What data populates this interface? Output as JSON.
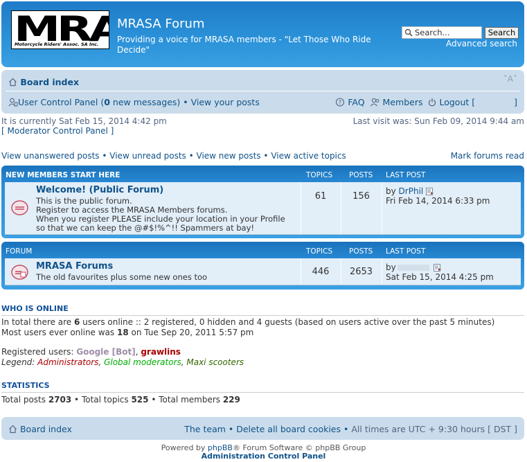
{
  "header": {
    "logo_text": "MRA",
    "logo_subtitle": "Motorcycle Riders' Assoc. SA Inc.",
    "site_title": "MRASA Forum",
    "site_description": "Providing a voice for MRASA members - \"Let Those Who Ride Decide\"",
    "search_placeholder": "Search...",
    "search_button": "Search",
    "advanced_search": "Advanced search"
  },
  "navbar": {
    "board_index": "Board index",
    "font_size": "˅A˄",
    "ucp_label": "User Control Panel",
    "ucp_open": " (",
    "new_messages_count": "0",
    "new_messages_text": " new messages)",
    "sep": " • ",
    "view_posts": "View your posts",
    "faq": "FAQ",
    "members": "Members",
    "logout": "Logout [",
    "logout_close": "]"
  },
  "info": {
    "current_time": "It is currently Sat Feb 15, 2014 4:42 pm",
    "mcp": "[ Moderator Control Panel ]",
    "last_visit": "Last visit was: Sun Feb 09, 2014 9:44 am"
  },
  "view_links": {
    "unanswered": "View unanswered posts",
    "unread": "View unread posts",
    "new": "View new posts",
    "active": "View active topics",
    "sep": " • ",
    "mark_read": "Mark forums read"
  },
  "columns": {
    "topics": "TOPICS",
    "posts": "POSTS",
    "last_post": "LAST POST"
  },
  "categories": [
    {
      "name": "NEW MEMBERS START HERE",
      "forum": {
        "title": "Welcome! (Public Forum)",
        "desc1": "This is the public forum.",
        "desc2": "Register to access the MRASA Members forums.",
        "desc3": "When you register PLEASE include your location in your Profile",
        "desc4": "so that we can keep the @#$!%^!! Spammers at bay!",
        "topics": "61",
        "posts": "156",
        "by": "by ",
        "last_author": "DrPhil",
        "last_date": "Fri Feb 14, 2014 6:33 pm"
      }
    },
    {
      "name": "FORUM",
      "forum": {
        "title": "MRASA Forums",
        "desc1": "The old favourites plus some new ones too",
        "topics": "446",
        "posts": "2653",
        "by": "by",
        "last_date": "Sat Feb 15, 2014 4:25 pm"
      }
    }
  ],
  "online": {
    "title": "WHO IS ONLINE",
    "l1_a": "In total there are ",
    "l1_count": "6",
    "l1_b": " users online :: 2 registered, 0 hidden and 4 guests (based on users active over the past 5 minutes)",
    "l2_a": "Most users ever online was ",
    "l2_count": "18",
    "l2_b": " on Tue Sep 20, 2011 5:57 pm",
    "reg_label": "Registered users: ",
    "user_bot": "Google [Bot]",
    "comma": ", ",
    "user2": "grawlins",
    "legend_label": "Legend: ",
    "legend_admin": "Administrators",
    "legend_gmod": "Global moderators",
    "legend_maxi": "Maxi scooters"
  },
  "stats": {
    "title": "STATISTICS",
    "posts_label": "Total posts ",
    "posts": "2703",
    "topics_label": " • Total topics ",
    "topics": "525",
    "members_label": " • Total members ",
    "members": "229"
  },
  "footer": {
    "board_index": "Board index",
    "team": "The team",
    "sep": " • ",
    "delete_cookies": "Delete all board cookies",
    "timezone": "All times are UTC + 9:30 hours [ DST ]",
    "powered_a": "Powered by ",
    "phpbb": "phpBB",
    "powered_b": "® Forum Software © phpBB Group",
    "acp": "Administration Control Panel"
  },
  "colors": {
    "header_blue": "#2a91d8",
    "navbar_bg": "#cadceb",
    "row_bg": "#e2eef8",
    "link": "#105289",
    "admin": "#AA0000",
    "gmod": "#00AA00",
    "maxi": "#336600",
    "bot": "#9E8DA7"
  }
}
